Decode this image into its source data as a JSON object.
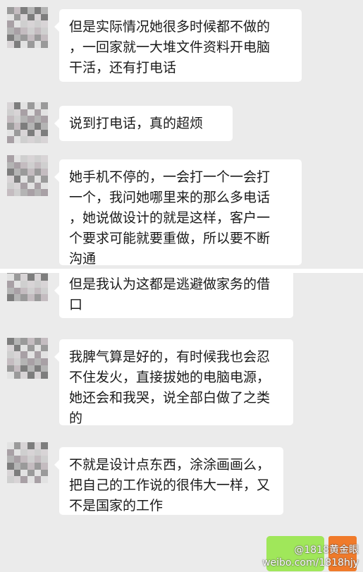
{
  "messages_top": [
    {
      "lines": [
        "但是实际情况她很多时候都不做的",
        "，一回家就一大堆文件资料开电脑",
        "干活，还有打电话"
      ]
    },
    {
      "lines": [
        "说到打电话，真的超烦"
      ]
    },
    {
      "lines": [
        "她手机不停的，一会打一个一会打",
        "一个，我问她哪里来的那么多电话",
        "，她说做设计的就是这样，客户一",
        "个要求可能就要重做，所以要不断",
        "沟通"
      ]
    }
  ],
  "messages_bottom": [
    {
      "lines": [
        "但是我认为这都是逃避做家务的借",
        "口"
      ]
    },
    {
      "lines": [
        "我脾气算是好的，有时候我也会忍",
        "不住发火，直接拔她的电脑电源，",
        "她还会和我哭，说全部白做了之类",
        "的"
      ]
    },
    {
      "lines": [
        "不就是设计点东西，涂涂画画么，",
        "把自己的工作说的很伟大一样，又",
        "不是国家的工作"
      ]
    }
  ],
  "watermark": {
    "line1": "@1818黄金眼",
    "line2": "weibo.com/1818hjy"
  },
  "colors": {
    "chat_background": "#ebebeb",
    "bubble": "#ffffff",
    "sent_bubble": "#a0e75a",
    "avatar_accent": "#f07a2a"
  }
}
